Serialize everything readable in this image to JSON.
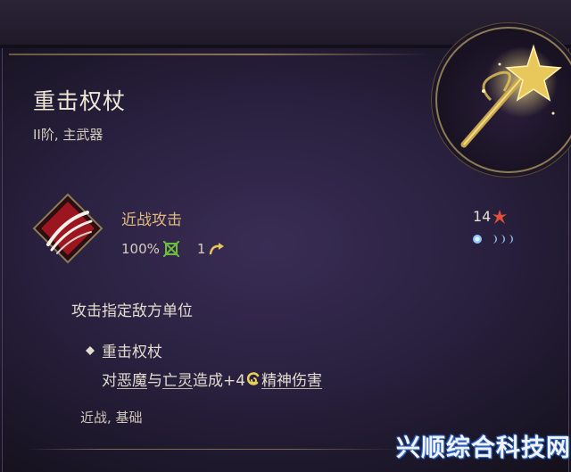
{
  "item": {
    "name": "重击权杖",
    "subtitle": "II阶, 主武器"
  },
  "action": {
    "name": "近战攻击",
    "hit_chance": "100%",
    "action_count": "1",
    "cost": "14",
    "description": "攻击指定敌方单位"
  },
  "property": {
    "name": "重击权杖",
    "effect_prefix": "对",
    "target_a": "恶魔",
    "conjunction": "与",
    "target_b": "亡灵",
    "effect_mid": "造成+4",
    "damage_type": "精神伤害"
  },
  "tags": "近战, 基础",
  "watermark": "兴顺综合科技网",
  "colors": {
    "action_name": "#e0b97d",
    "title": "#f0e7d8",
    "frame_gold": "#8d7a56",
    "skill_red": "#a01a24",
    "hit_green": "#6bbf3a",
    "cost_red": "#e0513a",
    "mana_blue": "#8fc6ff"
  },
  "icons": {
    "emblem": "mace-star-icon",
    "skill": "claw-slash-icon",
    "hit": "target-crosshair-icon",
    "action": "curved-arrow-icon",
    "cost": "burst-star-icon",
    "damage": "psychic-swirl-icon",
    "bullet": "diamond-bullet-icon"
  }
}
